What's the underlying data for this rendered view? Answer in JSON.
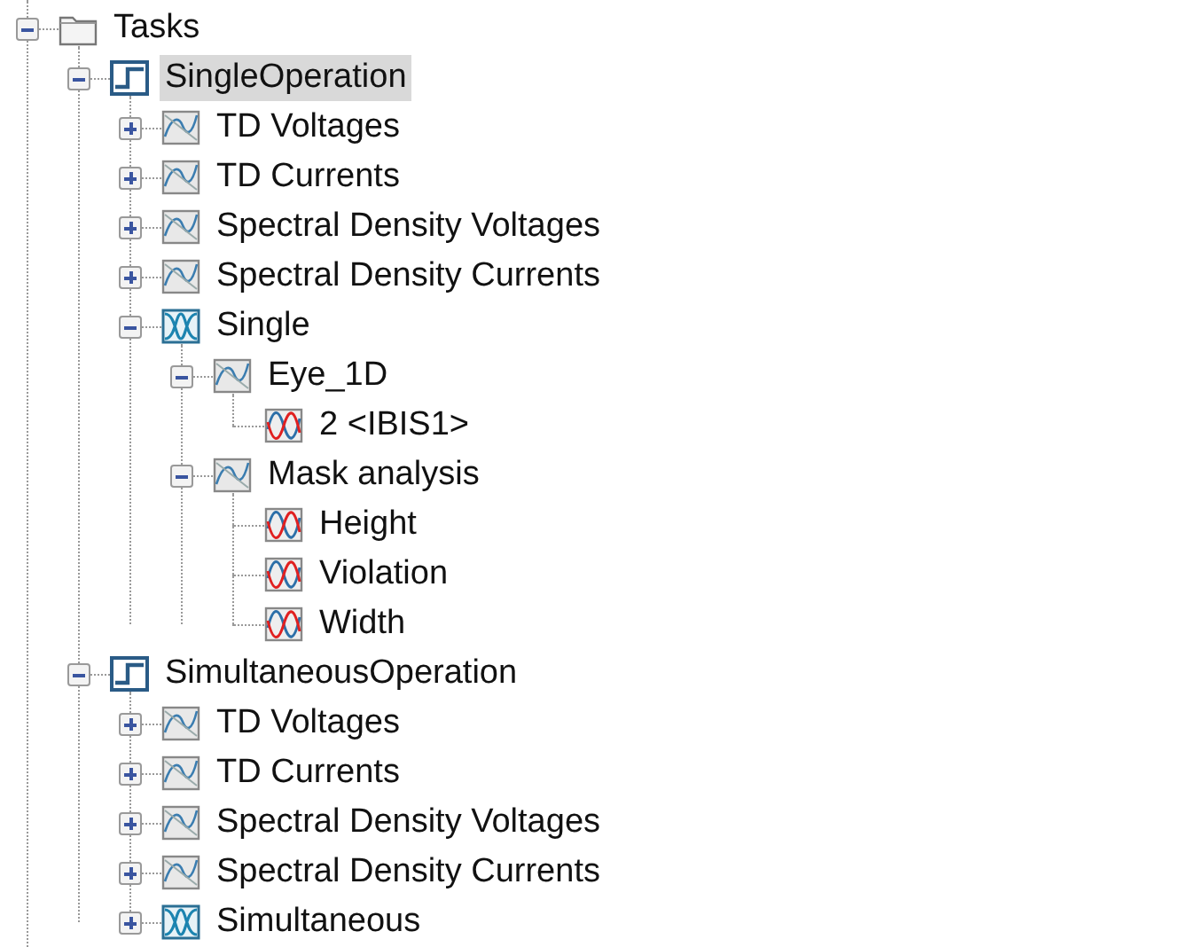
{
  "tree": [
    {
      "label": "Tasks",
      "kind": "folder",
      "expanded": true,
      "selected": false,
      "children": [
        {
          "label": "SingleOperation",
          "kind": "task",
          "expanded": true,
          "selected": true,
          "children": [
            {
              "label": "TD Voltages",
              "kind": "chart",
              "expanded": false,
              "selected": false
            },
            {
              "label": "TD Currents",
              "kind": "chart",
              "expanded": false,
              "selected": false
            },
            {
              "label": "Spectral Density Voltages",
              "kind": "chart",
              "expanded": false,
              "selected": false
            },
            {
              "label": "Spectral Density Currents",
              "kind": "chart",
              "expanded": false,
              "selected": false
            },
            {
              "label": "Single",
              "kind": "eye",
              "expanded": true,
              "selected": false,
              "children": [
                {
                  "label": "Eye_1D",
                  "kind": "chart",
                  "expanded": true,
                  "selected": false,
                  "children": [
                    {
                      "label": "2 <IBIS1>",
                      "kind": "curve",
                      "selected": false
                    }
                  ]
                },
                {
                  "label": "Mask analysis",
                  "kind": "chart",
                  "expanded": true,
                  "selected": false,
                  "children": [
                    {
                      "label": "Height",
                      "kind": "curve",
                      "selected": false
                    },
                    {
                      "label": "Violation",
                      "kind": "curve",
                      "selected": false
                    },
                    {
                      "label": "Width",
                      "kind": "curve",
                      "selected": false
                    }
                  ]
                }
              ]
            }
          ]
        },
        {
          "label": "SimultaneousOperation",
          "kind": "task",
          "expanded": true,
          "selected": false,
          "children": [
            {
              "label": "TD Voltages",
              "kind": "chart",
              "expanded": false,
              "selected": false
            },
            {
              "label": "TD Currents",
              "kind": "chart",
              "expanded": false,
              "selected": false
            },
            {
              "label": "Spectral Density Voltages",
              "kind": "chart",
              "expanded": false,
              "selected": false
            },
            {
              "label": "Spectral Density Currents",
              "kind": "chart",
              "expanded": false,
              "selected": false
            },
            {
              "label": "Simultaneous",
              "kind": "eye",
              "expanded": false,
              "selected": false
            }
          ]
        }
      ]
    }
  ]
}
